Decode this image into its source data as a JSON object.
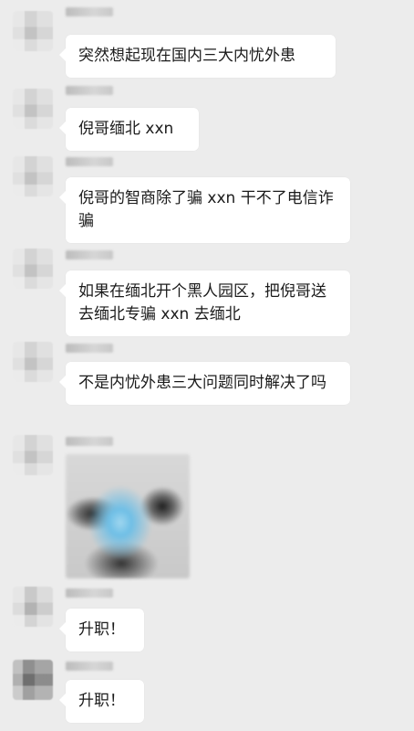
{
  "messages": [
    {
      "text": "突然想起现在国内三大内忧外患"
    },
    {
      "text": "倪哥缅北 xxn"
    },
    {
      "text": "倪哥的智商除了骗 xxn 干不了电信诈骗"
    },
    {
      "text": "如果在缅北开个黑人园区，把倪哥送去缅北专骗 xxn 去缅北"
    },
    {
      "text": "不是内忧外患三大问题同时解决了吗"
    },
    {
      "image": "blurred-photo"
    },
    {
      "text": "升职！"
    },
    {
      "text": "升职！"
    }
  ]
}
